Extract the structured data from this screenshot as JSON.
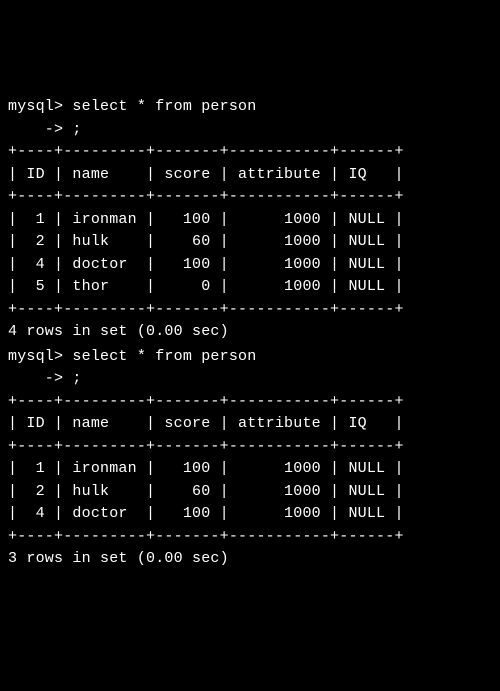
{
  "queries": [
    {
      "prompt": "mysql>",
      "command": "select * from person",
      "cont_prompt": "    ->",
      "cont_text": ";",
      "border": "+----+---------+-------+-----------+------+",
      "header": "| ID | name    | score | attribute | IQ   |",
      "rows": [
        "|  1 | ironman |   100 |      1000 | NULL |",
        "|  2 | hulk    |    60 |      1000 | NULL |",
        "|  4 | doctor  |   100 |      1000 | NULL |",
        "|  5 | thor    |     0 |      1000 | NULL |"
      ],
      "summary": "4 rows in set (0.00 sec)"
    },
    {
      "prompt": "mysql>",
      "command": "select * from person",
      "cont_prompt": "    ->",
      "cont_text": ";",
      "border": "+----+---------+-------+-----------+------+",
      "header": "| ID | name    | score | attribute | IQ   |",
      "rows": [
        "|  1 | ironman |   100 |      1000 | NULL |",
        "|  2 | hulk    |    60 |      1000 | NULL |",
        "|  4 | doctor  |   100 |      1000 | NULL |"
      ],
      "summary": "3 rows in set (0.00 sec)"
    }
  ],
  "chart_data": {
    "type": "table",
    "tables": [
      {
        "columns": [
          "ID",
          "name",
          "score",
          "attribute",
          "IQ"
        ],
        "rows": [
          [
            1,
            "ironman",
            100,
            1000,
            "NULL"
          ],
          [
            2,
            "hulk",
            60,
            1000,
            "NULL"
          ],
          [
            4,
            "doctor",
            100,
            1000,
            "NULL"
          ],
          [
            5,
            "thor",
            0,
            1000,
            "NULL"
          ]
        ],
        "row_count": 4,
        "exec_time_sec": 0.0
      },
      {
        "columns": [
          "ID",
          "name",
          "score",
          "attribute",
          "IQ"
        ],
        "rows": [
          [
            1,
            "ironman",
            100,
            1000,
            "NULL"
          ],
          [
            2,
            "hulk",
            60,
            1000,
            "NULL"
          ],
          [
            4,
            "doctor",
            100,
            1000,
            "NULL"
          ]
        ],
        "row_count": 3,
        "exec_time_sec": 0.0
      }
    ]
  }
}
